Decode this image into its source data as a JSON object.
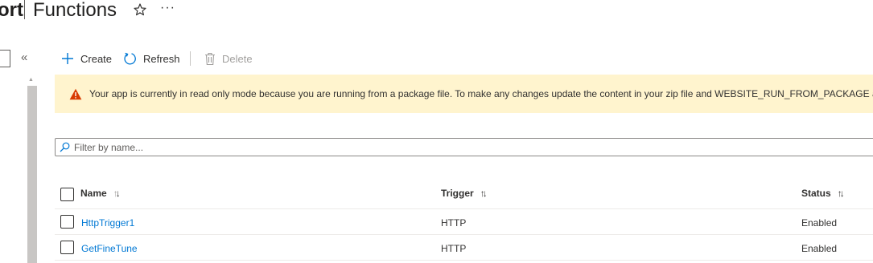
{
  "header": {
    "title_prefix": "ort",
    "title": "Functions",
    "more_label": "···"
  },
  "nav": {
    "collapse_label": "«"
  },
  "toolbar": {
    "create_label": "Create",
    "refresh_label": "Refresh",
    "delete_label": "Delete"
  },
  "banner": {
    "message": "Your app is currently in read only mode because you are running from a package file. To make any changes update the content in your zip file and WEBSITE_RUN_FROM_PACKAGE app se"
  },
  "filter": {
    "placeholder": "Filter by name..."
  },
  "table": {
    "columns": [
      {
        "label": "Name"
      },
      {
        "label": "Trigger"
      },
      {
        "label": "Status"
      }
    ],
    "rows": [
      {
        "name": "HttpTrigger1",
        "trigger": "HTTP",
        "status": "Enabled"
      },
      {
        "name": "GetFineTune",
        "trigger": "HTTP",
        "status": "Enabled"
      }
    ]
  },
  "colors": {
    "link": "#0078d4",
    "warning_banner": "#fff4ce",
    "warning_icon": "#d83b01"
  }
}
